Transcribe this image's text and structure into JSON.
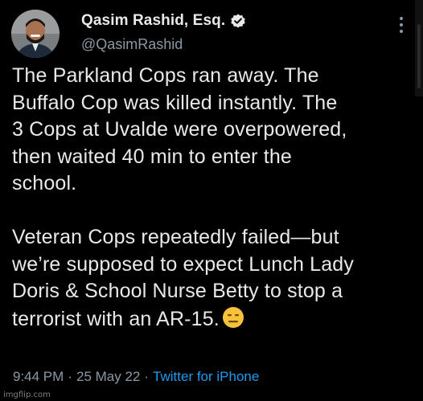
{
  "author": {
    "display_name": "Qasim Rashid, Esq.",
    "handle": "@QasimRashid",
    "verified": true
  },
  "tweet": {
    "text_lines": [
      "The Parkland Cops ran away. The",
      "Buffalo Cop was killed instantly. The",
      "3 Cops at Uvalde were overpowered,",
      "then waited 40 min to enter the",
      "school.",
      "",
      "Veteran Cops repeatedly failed—but",
      "we’re supposed to expect Lunch Lady",
      "Doris & School Nurse Betty to stop a",
      "terrorist with an AR-15."
    ],
    "emoji": "expressionless-face-emoji"
  },
  "meta": {
    "time": "9:44 PM",
    "separator": "·",
    "date": "25 May 22",
    "source": "Twitter for iPhone"
  },
  "watermark": "imgflip.com",
  "colors": {
    "background": "#000000",
    "text": "#e7e9ea",
    "secondary": "#8b98a5",
    "link": "#1d9bf0",
    "verified": "#e7e9ea"
  }
}
